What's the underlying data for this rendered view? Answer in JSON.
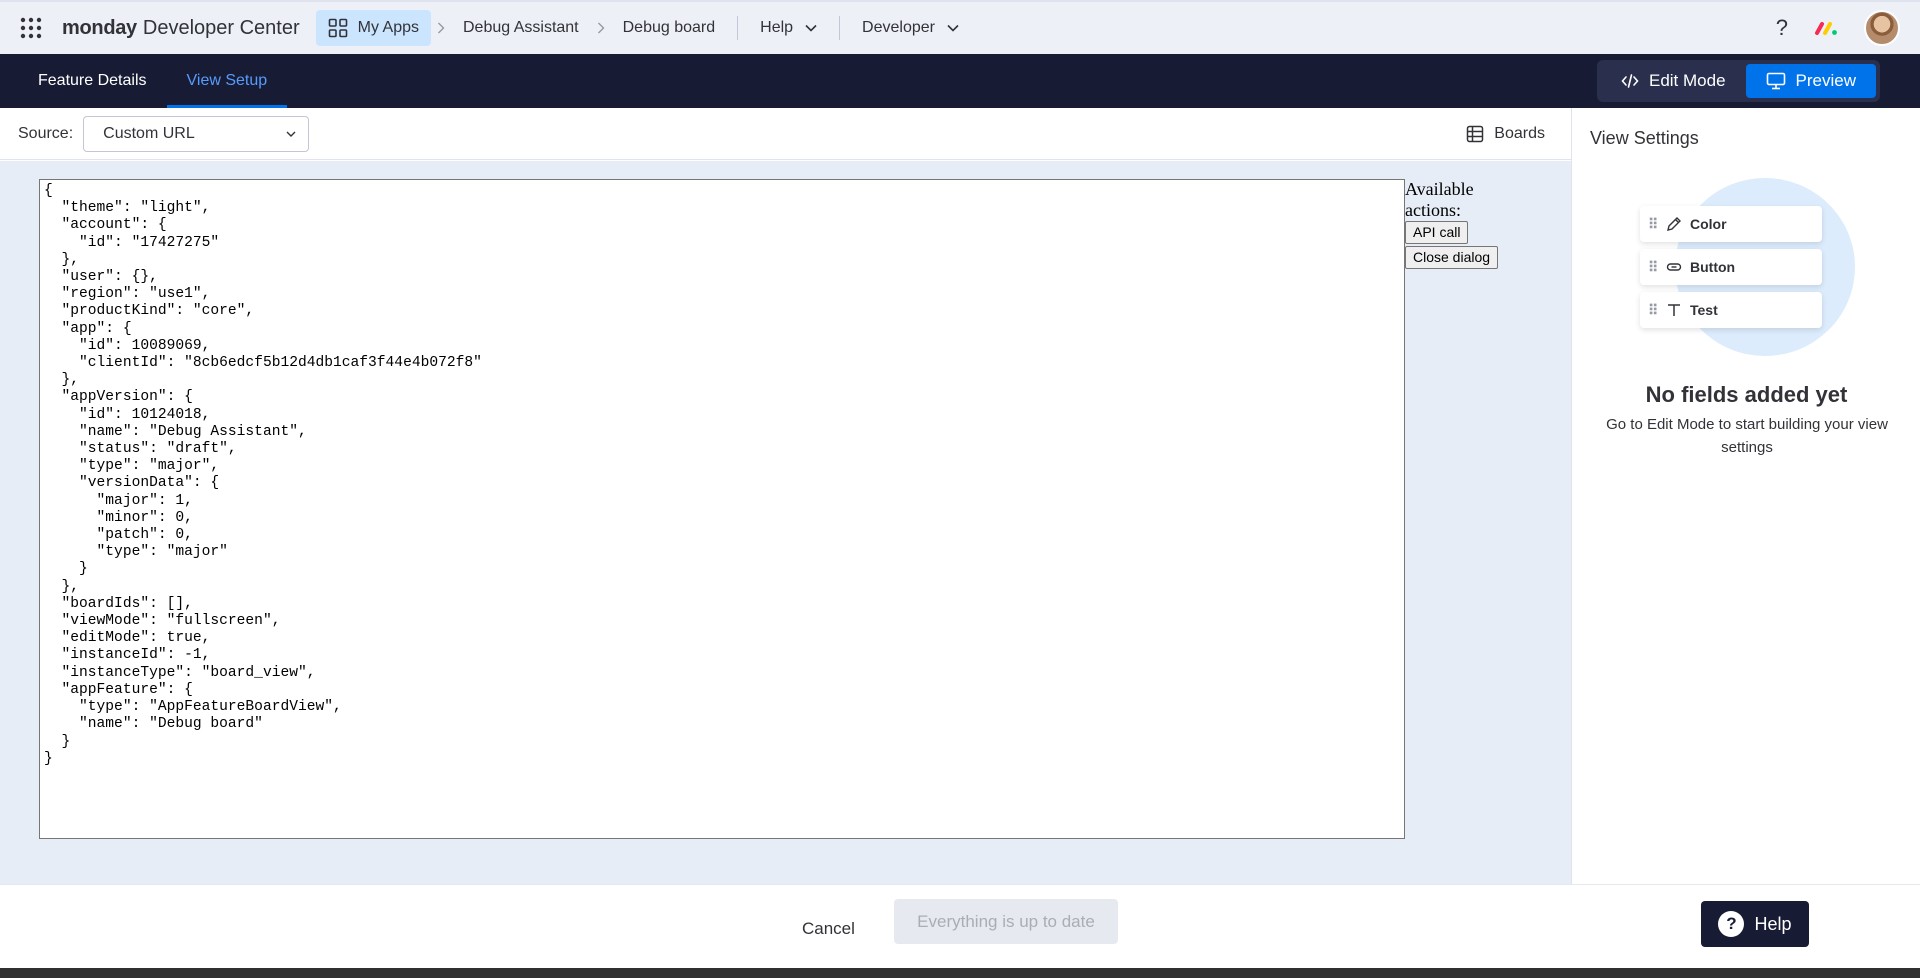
{
  "topnav": {
    "brand_bold": "monday",
    "brand_rest": "Developer Center",
    "breadcrumbs": [
      "My Apps",
      "Debug Assistant",
      "Debug board"
    ],
    "menus": [
      "Help",
      "Developer"
    ],
    "help_symbol": "?"
  },
  "subnav": {
    "tabs": [
      "Feature Details",
      "View Setup"
    ],
    "active_tab": "View Setup",
    "edit_mode_label": "Edit Mode",
    "preview_label": "Preview",
    "selected_mode": "Preview"
  },
  "source": {
    "label": "Source:",
    "selected": "Custom URL",
    "boards_label": "Boards"
  },
  "context_json": "{\n  \"theme\": \"light\",\n  \"account\": {\n    \"id\": \"17427275\"\n  },\n  \"user\": {},\n  \"region\": \"use1\",\n  \"productKind\": \"core\",\n  \"app\": {\n    \"id\": 10089069,\n    \"clientId\": \"8cb6edcf5b12d4db1caf3f44e4b072f8\"\n  },\n  \"appVersion\": {\n    \"id\": 10124018,\n    \"name\": \"Debug Assistant\",\n    \"status\": \"draft\",\n    \"type\": \"major\",\n    \"versionData\": {\n      \"major\": 1,\n      \"minor\": 0,\n      \"patch\": 0,\n      \"type\": \"major\"\n    }\n  },\n  \"boardIds\": [],\n  \"viewMode\": \"fullscreen\",\n  \"editMode\": true,\n  \"instanceId\": -1,\n  \"instanceType\": \"board_view\",\n  \"appFeature\": {\n    \"type\": \"AppFeatureBoardView\",\n    \"name\": \"Debug board\"\n  }\n}",
  "actions": {
    "heading": "Available actions:",
    "buttons": [
      "API call",
      "Close dialog"
    ]
  },
  "view_settings": {
    "title": "View Settings",
    "field_cards": [
      {
        "label": "Color",
        "icon": "pen-icon"
      },
      {
        "label": "Button",
        "icon": "link-pill-icon"
      },
      {
        "label": "Test",
        "icon": "text-t-icon"
      }
    ],
    "empty_title": "No fields added yet",
    "empty_sub": "Go to Edit Mode to start building your view settings"
  },
  "footer": {
    "cancel_label": "Cancel",
    "status_label": "Everything is up to date",
    "help_label": "Help",
    "help_symbol": "?"
  },
  "colors": {
    "accent": "#0073ea",
    "dark_nav": "#181b34",
    "canvas": "#e7edf7"
  }
}
